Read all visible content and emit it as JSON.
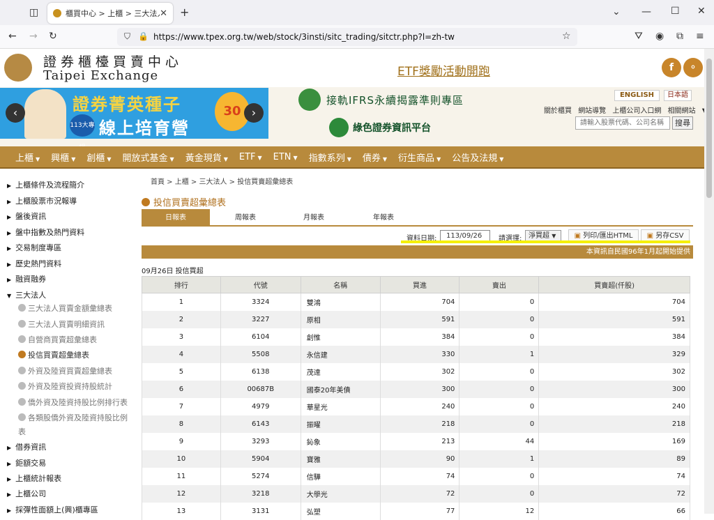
{
  "browser": {
    "tab_title": "櫃買中心 > 上櫃 > 三大法人 >",
    "url": "https://www.tpex.org.tw/web/stock/3insti/sitc_trading/sitctr.php?l=zh-tw"
  },
  "header": {
    "logo_zh": "證券櫃檯買賣中心",
    "logo_en": "Taipei Exchange",
    "etf_link": "ETF獎勵活動開跑",
    "facebook": "f"
  },
  "banner": {
    "carousel_title1": "證券菁英種子",
    "carousel_title2": "線上培育營",
    "carousel_badge": "113大專組",
    "carousel_ribbon": "30",
    "ifrs": "接軌IFRS永續揭露準則專區",
    "green": "綠色證券資訊平台",
    "lang_en": "ENGLISH",
    "lang_jp": "日本語",
    "quicklinks": [
      "關於櫃買",
      "網站導覽",
      "上櫃公司入口網",
      "相關網站"
    ],
    "search_placeholder": "請輸入股票代碼、公司名稱",
    "search_button": "搜尋"
  },
  "mainmenu": [
    "上櫃",
    "興櫃",
    "創櫃",
    "開放式基金",
    "黃金現貨",
    "ETF",
    "ETN",
    "指數系列",
    "債券",
    "衍生商品",
    "公告及法規"
  ],
  "sidebar": {
    "items": [
      "上櫃條件及流程簡介",
      "上櫃股票市況報導",
      "盤後資訊",
      "盤中指數及熱門資料",
      "交易制度專區",
      "歷史熱門資料",
      "融資融券",
      "三大法人"
    ],
    "subitems": [
      "三大法人買賣金額彙總表",
      "三大法人買賣明細資訊",
      "自營商買賣超彙總表",
      "投信買賣超彙總表",
      "外資及陸資買賣超彙總表",
      "外資及陸資投資持股統計",
      "僑外資及陸資持股比例排行表",
      "各類股僑外資及陸資持股比例表"
    ],
    "items_after": [
      "借券資訊",
      "鉅額交易",
      "上櫃統計報表",
      "上櫃公司",
      "採彈性面額上(興)櫃專區"
    ]
  },
  "content": {
    "breadcrumb": "首頁 > 上櫃 > 三大法人 > 投信買賣超彙總表",
    "title": "投信買賣超彙總表",
    "tabs": [
      "日報表",
      "周報表",
      "月報表",
      "年報表"
    ],
    "date_label": "資料日期:",
    "date_value": "113/09/26",
    "select_label": "請選擇:",
    "select_value": "淨買超",
    "print_button": "列印/匯出HTML",
    "csv_button": "另存CSV",
    "info_bar": "本資訊自民國96年1月起開始提供",
    "caption": "09月26日 投信買超"
  },
  "table": {
    "headers": [
      "排行",
      "代號",
      "名稱",
      "買進",
      "賣出",
      "買賣超(仟股)"
    ],
    "rows": [
      [
        "1",
        "3324",
        "雙鴻",
        "704",
        "0",
        "704"
      ],
      [
        "2",
        "3227",
        "原相",
        "591",
        "0",
        "591"
      ],
      [
        "3",
        "6104",
        "創惟",
        "384",
        "0",
        "384"
      ],
      [
        "4",
        "5508",
        "永信建",
        "330",
        "1",
        "329"
      ],
      [
        "5",
        "6138",
        "茂達",
        "302",
        "0",
        "302"
      ],
      [
        "6",
        "00687B",
        "國泰20年美債",
        "300",
        "0",
        "300"
      ],
      [
        "7",
        "4979",
        "華星光",
        "240",
        "0",
        "240"
      ],
      [
        "8",
        "6143",
        "振曜",
        "218",
        "0",
        "218"
      ],
      [
        "9",
        "3293",
        "鈊象",
        "213",
        "44",
        "169"
      ],
      [
        "10",
        "5904",
        "寶雅",
        "90",
        "1",
        "89"
      ],
      [
        "11",
        "5274",
        "信驊",
        "74",
        "0",
        "74"
      ],
      [
        "12",
        "3218",
        "大學光",
        "72",
        "0",
        "72"
      ],
      [
        "13",
        "3131",
        "弘塑",
        "77",
        "12",
        "66"
      ]
    ]
  }
}
